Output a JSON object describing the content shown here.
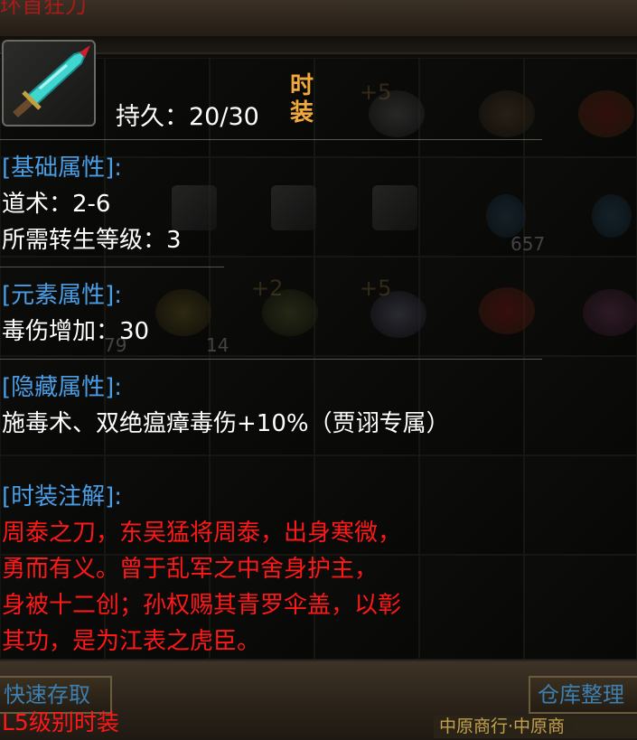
{
  "window": {
    "title": "环首狂刀"
  },
  "inventory": {
    "counts": [
      "657",
      "79",
      "14"
    ],
    "plus_marks": [
      "+5",
      "+2",
      "+5"
    ],
    "buttons": {
      "quick_store": "快速存取",
      "warehouse_sort": "仓库整理"
    },
    "strip_text": "中原商行·中原商"
  },
  "tooltip": {
    "durability_label": "持久：20/30",
    "fashion_badge_top": "时",
    "fashion_badge_bottom": "装",
    "basic": {
      "heading": "[基础属性]:",
      "lines": [
        "道术：2-6",
        "所需转生等级：3"
      ]
    },
    "element": {
      "heading": "[元素属性]:",
      "lines": [
        "毒伤增加：30"
      ]
    },
    "hidden": {
      "heading": "[隐藏属性]:",
      "lines": [
        "施毒术、双绝瘟瘴毒伤+10%（贾诩专属）"
      ]
    },
    "annotation": {
      "heading": "[时装注解]:",
      "lines": [
        "周泰之刀，东吴猛将周泰，出身寒微，",
        "勇而有义。曾于乱军之中舍身护主，",
        "身被十二创；孙权赐其青罗伞盖，以彰",
        "其功，是为江表之虎臣。"
      ]
    },
    "footer": "L5级别时装"
  },
  "colors": {
    "heading_blue": "#4a9ee6",
    "lore_red": "#ff1818",
    "badge_orange": "#f2a93b"
  }
}
